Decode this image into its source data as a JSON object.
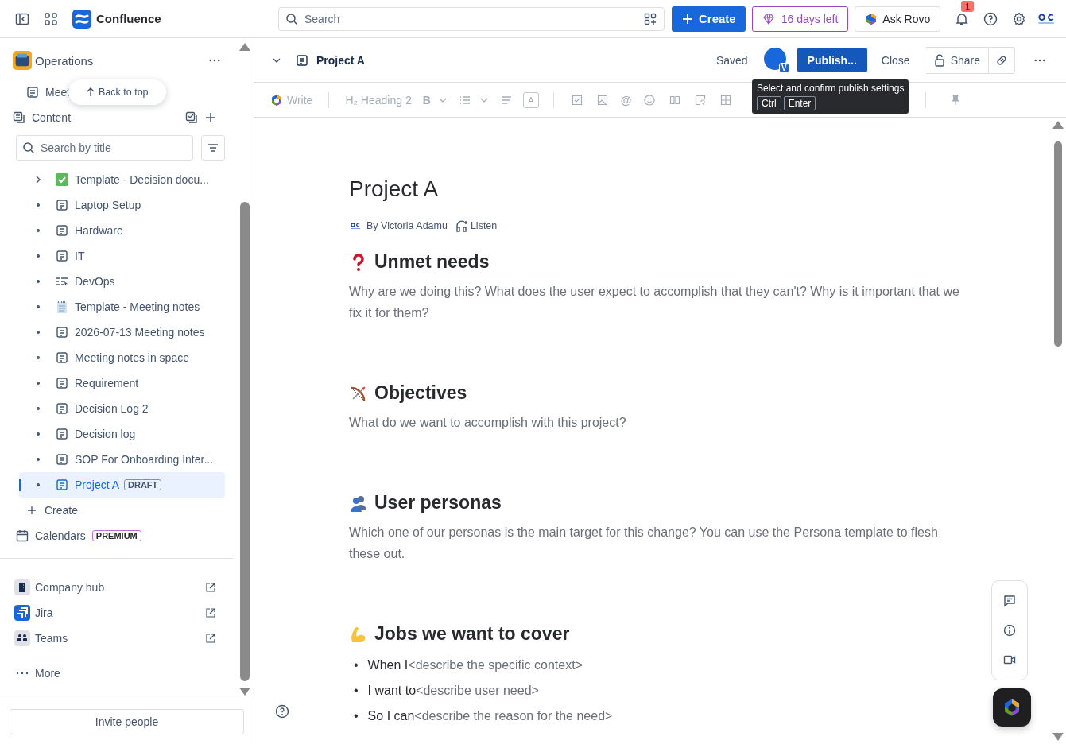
{
  "topbar": {
    "product": "Confluence",
    "search": {
      "placeholder": "Search"
    },
    "create": "Create",
    "trial": "16 days left",
    "rovo": "Ask Rovo",
    "notifications": "1"
  },
  "sidebar": {
    "space": "Operations",
    "recent": "Meet",
    "back_to_top": "Back to top",
    "content_label": "Content",
    "filter": {
      "placeholder": "Search by title"
    },
    "tree": [
      {
        "title": "Template - Decision docu...",
        "kind": "check",
        "expandable": true,
        "selected": false
      },
      {
        "title": "Laptop Setup",
        "kind": "page",
        "expandable": false,
        "selected": false
      },
      {
        "title": "Hardware",
        "kind": "page",
        "expandable": false,
        "selected": false
      },
      {
        "title": "IT",
        "kind": "page",
        "expandable": false,
        "selected": false
      },
      {
        "title": "DevOps",
        "kind": "list",
        "expandable": false,
        "selected": false
      },
      {
        "title": "Template - Meeting notes",
        "kind": "notepad",
        "expandable": false,
        "selected": false
      },
      {
        "title": "2026-07-13 Meeting notes",
        "kind": "page",
        "expandable": false,
        "selected": false
      },
      {
        "title": "Meeting notes in space",
        "kind": "page",
        "expandable": false,
        "selected": false
      },
      {
        "title": "Requirement",
        "kind": "page",
        "expandable": false,
        "selected": false
      },
      {
        "title": "Decision Log 2",
        "kind": "page",
        "expandable": false,
        "selected": false
      },
      {
        "title": "Decision log",
        "kind": "page",
        "expandable": false,
        "selected": false
      },
      {
        "title": "SOP For Onboarding Inter...",
        "kind": "page",
        "expandable": false,
        "selected": false
      },
      {
        "title": "Project A",
        "kind": "page",
        "expandable": false,
        "selected": true,
        "badge": "DRAFT"
      }
    ],
    "create": "Create",
    "calendars": "Calendars",
    "calendars_badge": "PREMIUM",
    "apps": [
      {
        "name": "Company hub"
      },
      {
        "name": "Jira"
      },
      {
        "name": "Teams"
      }
    ],
    "more": "More",
    "invite": "Invite people"
  },
  "editor": {
    "page_title": "Project A",
    "status": "Saved",
    "collaborator_badge": "V",
    "publish": "Publish...",
    "close": "Close",
    "share": "Share",
    "toolbar": [
      {
        "kind": "ai",
        "label": "Write"
      },
      {
        "kind": "divider"
      },
      {
        "kind": "heading",
        "glyph": "H₂",
        "label": "Heading 2"
      },
      {
        "kind": "glyph",
        "label": "B"
      },
      {
        "kind": "caret"
      },
      {
        "kind": "bullets"
      },
      {
        "kind": "caret"
      },
      {
        "kind": "align"
      },
      {
        "kind": "boxed",
        "label": "A"
      },
      {
        "kind": "divider"
      },
      {
        "kind": "checkbox"
      },
      {
        "kind": "image"
      },
      {
        "kind": "glyph",
        "label": "@"
      },
      {
        "kind": "emoji"
      },
      {
        "kind": "columns"
      },
      {
        "kind": "layout"
      },
      {
        "kind": "table"
      }
    ],
    "tooltip": {
      "text": "Select and confirm publish settings",
      "keys": [
        "Ctrl",
        "Enter"
      ]
    }
  },
  "document": {
    "title": "Project A",
    "author": "By Victoria Adamu",
    "listen": "Listen",
    "sections": [
      {
        "heading": "Unmet needs",
        "kind": "paragraph",
        "text": "Why are we doing this? What does the user expect to accomplish that they can't? Why is it important that we fix it for them?"
      },
      {
        "heading": "Objectives",
        "kind": "paragraph",
        "text": "What do we want to accomplish with this project?"
      },
      {
        "heading": "User personas",
        "kind": "paragraph",
        "text": "Which one of our personas is the main target for this change? You can use the Persona template to flesh these out."
      },
      {
        "heading": "Jobs we want to cover",
        "kind": "list",
        "items": [
          {
            "bullet": "•",
            "lead": "When I",
            "hint": "<describe the specific context>"
          },
          {
            "bullet": "•",
            "lead": "I want to",
            "hint": "<describe user need>"
          },
          {
            "bullet": "•",
            "lead": "So I can",
            "hint": "<describe the reason for the need>"
          }
        ]
      }
    ]
  }
}
